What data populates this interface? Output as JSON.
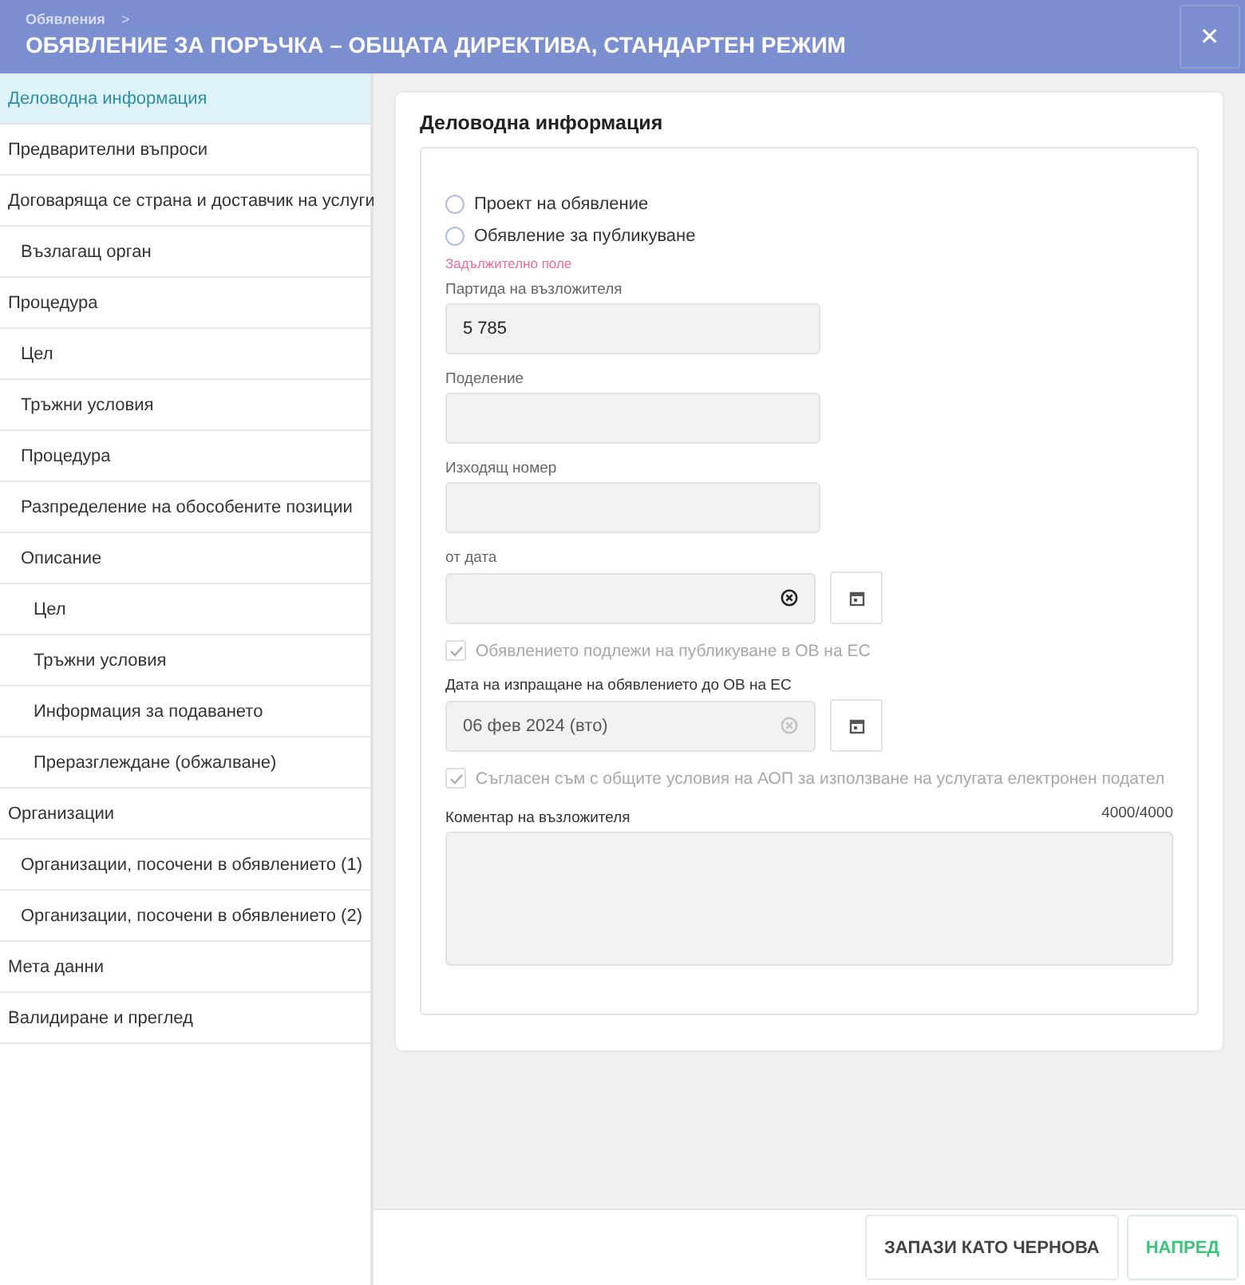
{
  "header": {
    "breadcrumb": "Обявления",
    "breadcrumb_separator": ">",
    "title": "ОБЯВЛЕНИЕ ЗА ПОРЪЧКА – ОБЩАТА ДИРЕКТИВА, СТАНДАРТЕН РЕЖИМ",
    "close": "✕"
  },
  "sidebar": {
    "items": [
      {
        "label": "Деловодна информация",
        "selected": true
      },
      {
        "label": "Предварителни въпроси",
        "selected": false
      },
      {
        "label": "Договаряща се страна и доставчик на услуги",
        "selected": false,
        "children": [
          {
            "label": "Възлагащ орган",
            "selected": false
          }
        ]
      },
      {
        "label": "Процедура",
        "selected": false,
        "children": [
          {
            "label": "Цел",
            "selected": false
          },
          {
            "label": "Тръжни условия",
            "selected": false
          },
          {
            "label": "Процедура",
            "selected": false
          },
          {
            "label": "Разпределение на обособените позиции",
            "selected": false
          },
          {
            "label": "Описание",
            "selected": false,
            "children": [
              {
                "label": "Цел",
                "selected": false
              },
              {
                "label": "Тръжни условия",
                "selected": false
              },
              {
                "label": "Информация за подаването",
                "selected": false
              },
              {
                "label": "Преразглеждане (обжалване)",
                "selected": false
              }
            ]
          }
        ]
      },
      {
        "label": "Организации",
        "selected": false,
        "children": [
          {
            "label": "Организации, посочени в обявлението (1)",
            "selected": false
          },
          {
            "label": "Организации, посочени в обявлението (2)",
            "selected": false
          }
        ]
      },
      {
        "label": "Мета данни",
        "selected": false
      },
      {
        "label": "Валидиране и преглед",
        "selected": false
      }
    ]
  },
  "form": {
    "title": "Деловодна информация",
    "items": [
      {
        "kind": "radio",
        "label": "Проект на обявление",
        "selected": false
      },
      {
        "kind": "radio",
        "label": "Обявление за публикуване",
        "selected": false
      },
      {
        "kind": "error",
        "label": "Задължително поле"
      },
      {
        "kind": "text",
        "label": "Партида на възложителя",
        "value": "5 785"
      },
      {
        "kind": "text",
        "label": "Поделение"
      },
      {
        "kind": "text",
        "label": "Изходящ номер"
      },
      {
        "kind": "date",
        "label": "от дата",
        "disabled": false
      },
      {
        "kind": "checkbox",
        "label": "Обявлението подлежи на публикуване в ОВ на ЕС",
        "checked": true,
        "disabled": true
      },
      {
        "kind": "date",
        "label": "Дата на изпращане на обявлението до ОВ на ЕС",
        "value": "06 фев 2024 (вто)",
        "disabled": true
      },
      {
        "kind": "checkbox",
        "label": "Съгласен съм с общите условия на АОП за използване на услугата електронен подател",
        "checked": true,
        "disabled": true
      },
      {
        "kind": "textarea",
        "label": "Коментар на възложителя",
        "counter": "4000/4000"
      }
    ]
  },
  "footer": {
    "buttons": [
      {
        "label": "ЗАПАЗИ КАТО ЧЕРНОВА",
        "kind": "secondary"
      },
      {
        "label": "НАПРЕД",
        "kind": "primary"
      }
    ]
  }
}
